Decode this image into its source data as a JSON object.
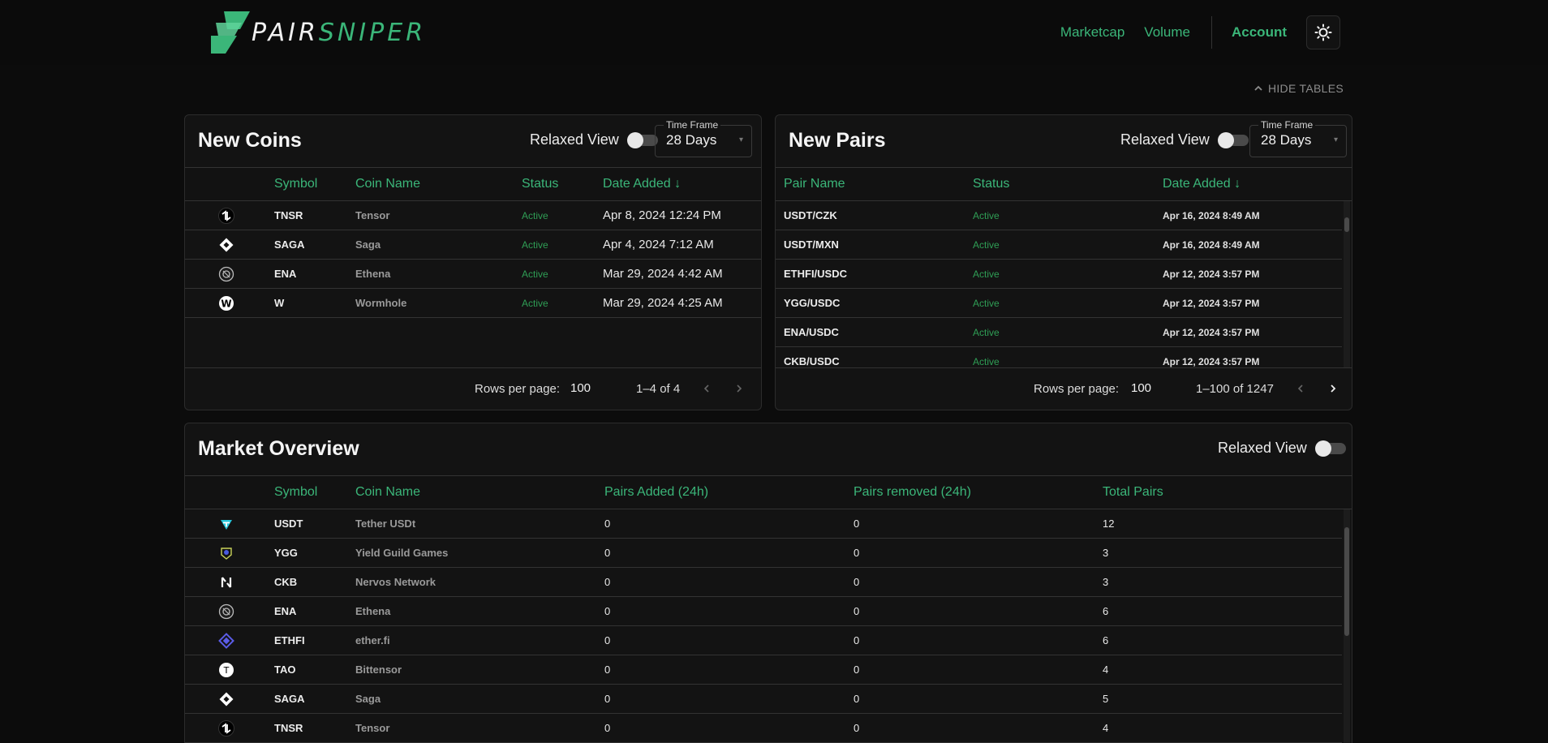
{
  "brand": {
    "name_part1": "PAIR",
    "name_part2": "SNIPER"
  },
  "nav": {
    "marketcap": "Marketcap",
    "volume": "Volume",
    "account": "Account"
  },
  "hide_tables": "HIDE TABLES",
  "colors": {
    "accent": "#3bb679",
    "status_active": "#2f9e55",
    "background": "#0c0c0c",
    "panel": "#131313"
  },
  "new_coins": {
    "title": "New Coins",
    "relaxed_label": "Relaxed View",
    "timeframe_label": "Time Frame",
    "timeframe_value": "28 Days",
    "headers": {
      "symbol": "Symbol",
      "coin_name": "Coin Name",
      "status": "Status",
      "date_added": "Date Added"
    },
    "rows": [
      {
        "icon": "tensor-icon",
        "symbol": "TNSR",
        "name": "Tensor",
        "status": "Active",
        "date": "Apr 8, 2024 12:24 PM"
      },
      {
        "icon": "saga-icon",
        "symbol": "SAGA",
        "name": "Saga",
        "status": "Active",
        "date": "Apr 4, 2024 7:12 AM"
      },
      {
        "icon": "ethena-icon",
        "symbol": "ENA",
        "name": "Ethena",
        "status": "Active",
        "date": "Mar 29, 2024 4:42 AM"
      },
      {
        "icon": "wormhole-icon",
        "symbol": "W",
        "name": "Wormhole",
        "status": "Active",
        "date": "Mar 29, 2024 4:25 AM"
      }
    ],
    "rows_per_page_label": "Rows per page:",
    "rows_per_page": "100",
    "range": "1–4 of 4"
  },
  "new_pairs": {
    "title": "New Pairs",
    "relaxed_label": "Relaxed View",
    "timeframe_label": "Time Frame",
    "timeframe_value": "28 Days",
    "headers": {
      "pair_name": "Pair Name",
      "status": "Status",
      "date_added": "Date Added"
    },
    "rows": [
      {
        "pair": "USDT/CZK",
        "status": "Active",
        "date": "Apr 16, 2024 8:49 AM"
      },
      {
        "pair": "USDT/MXN",
        "status": "Active",
        "date": "Apr 16, 2024 8:49 AM"
      },
      {
        "pair": "ETHFI/USDC",
        "status": "Active",
        "date": "Apr 12, 2024 3:57 PM"
      },
      {
        "pair": "YGG/USDC",
        "status": "Active",
        "date": "Apr 12, 2024 3:57 PM"
      },
      {
        "pair": "ENA/USDC",
        "status": "Active",
        "date": "Apr 12, 2024 3:57 PM"
      },
      {
        "pair": "CKB/USDC",
        "status": "Active",
        "date": "Apr 12, 2024 3:57 PM"
      }
    ],
    "rows_per_page_label": "Rows per page:",
    "rows_per_page": "100",
    "range": "1–100 of 1247"
  },
  "market_overview": {
    "title": "Market Overview",
    "relaxed_label": "Relaxed View",
    "headers": {
      "symbol": "Symbol",
      "coin_name": "Coin Name",
      "pairs_added": "Pairs Added (24h)",
      "pairs_removed": "Pairs removed (24h)",
      "total_pairs": "Total Pairs"
    },
    "rows": [
      {
        "icon": "tether-icon",
        "symbol": "USDT",
        "name": "Tether USDt",
        "added": "0",
        "removed": "0",
        "total": "12"
      },
      {
        "icon": "ygg-icon",
        "symbol": "YGG",
        "name": "Yield Guild Games",
        "added": "0",
        "removed": "0",
        "total": "3"
      },
      {
        "icon": "nervos-icon",
        "symbol": "CKB",
        "name": "Nervos Network",
        "added": "0",
        "removed": "0",
        "total": "3"
      },
      {
        "icon": "ethena-icon",
        "symbol": "ENA",
        "name": "Ethena",
        "added": "0",
        "removed": "0",
        "total": "6"
      },
      {
        "icon": "etherfi-icon",
        "symbol": "ETHFI",
        "name": "ether.fi",
        "added": "0",
        "removed": "0",
        "total": "6"
      },
      {
        "icon": "bittensor-icon",
        "symbol": "TAO",
        "name": "Bittensor",
        "added": "0",
        "removed": "0",
        "total": "4"
      },
      {
        "icon": "saga-icon",
        "symbol": "SAGA",
        "name": "Saga",
        "added": "0",
        "removed": "0",
        "total": "5"
      },
      {
        "icon": "tensor-icon",
        "symbol": "TNSR",
        "name": "Tensor",
        "added": "0",
        "removed": "0",
        "total": "4"
      }
    ]
  }
}
